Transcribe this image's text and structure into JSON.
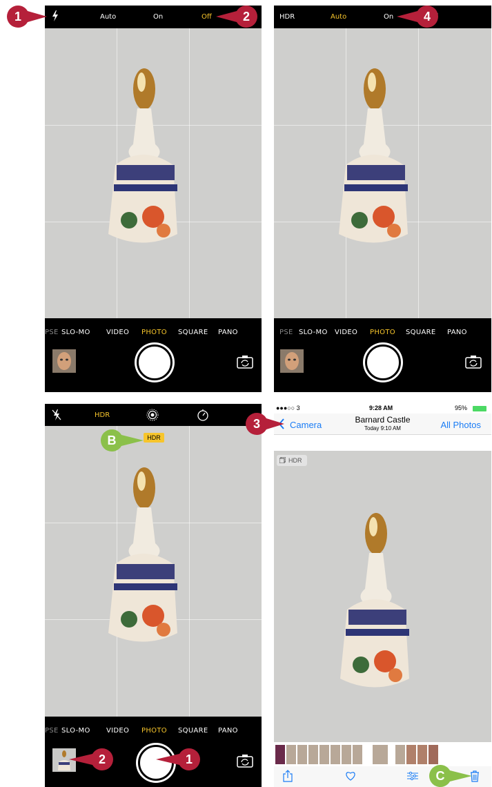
{
  "camera_top": {
    "flash_modes": [
      "Auto",
      "On",
      "Off"
    ],
    "flash_selected": "Off"
  },
  "camera_top_hdr": {
    "hdr_label": "HDR",
    "modes": [
      "Auto",
      "On",
      "f"
    ],
    "selected": "Auto"
  },
  "camera_top_3": {
    "hdr_label": "HDR"
  },
  "hdr_indicator": "HDR",
  "mode_bar": {
    "items": [
      "PSE",
      "SLO-MO",
      "VIDEO",
      "PHOTO",
      "SQUARE",
      "PANO"
    ],
    "selected": "PHOTO"
  },
  "photo_viewer": {
    "status": {
      "carrier": "●●●○○ 3",
      "time": "9:28 AM",
      "battery": "95%"
    },
    "nav": {
      "back_label": "Camera",
      "title": "Barnard Castle",
      "subtitle": "Today 9:10 AM",
      "right_label": "All Photos"
    },
    "hdr_badge": "HDR"
  },
  "callouts": {
    "c1": "1",
    "c2": "2",
    "c4": "4",
    "c3": "3",
    "cB": "B",
    "c2b": "2",
    "c1b": "1",
    "cC": "C"
  },
  "colors": {
    "accent_yellow": "#f7c52b",
    "callout_red": "#b5203a",
    "callout_green": "#8bc04a",
    "ios_blue": "#1a7cf5"
  }
}
